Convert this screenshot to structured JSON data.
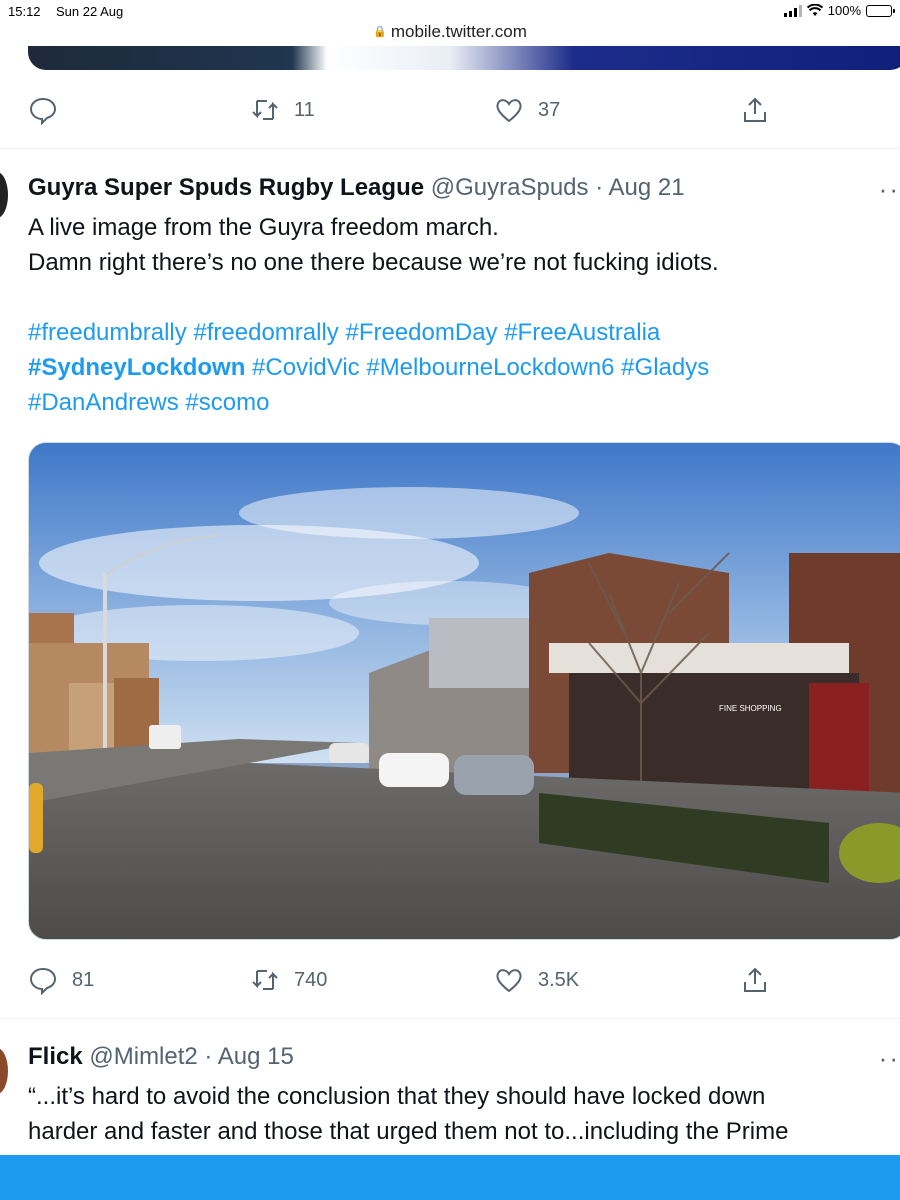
{
  "status_bar": {
    "time": "15:12",
    "date": "Sun 22 Aug",
    "battery": "100%"
  },
  "browser": {
    "url": "mobile.twitter.com"
  },
  "prev_tweet_actions": {
    "replies": "",
    "retweets": "11",
    "likes": "37"
  },
  "tweet": {
    "name": "Guyra Super Spuds Rugby League",
    "handle": "@GuyraSpuds",
    "separator": "·",
    "date": "Aug 21",
    "more": "··",
    "text_lines": [
      "A live image from the Guyra freedom march.",
      "Damn right there’s no one there because we’re not fucking idiots."
    ],
    "hashtags": {
      "line1": "#freedumbrally #freedomrally #FreedomDay #FreeAustralia",
      "line2_bold": "#SydneyLockdown",
      "line2_rest": " #CovidVic #MelbourneLockdown6 #Gladys",
      "line3": "#DanAndrews #scomo"
    },
    "photo": {
      "shop_sign": "FINE SHOPPING"
    },
    "actions": {
      "replies": "81",
      "retweets": "740",
      "likes": "3.5K"
    }
  },
  "next_tweet": {
    "name": "Flick",
    "handle": "@Mimlet2",
    "separator": "·",
    "date": "Aug 15",
    "more": "··",
    "text_lines": [
      "“...it’s hard to avoid the conclusion that they should have locked down",
      "harder and faster and those that urged them not to...including the Prime"
    ]
  },
  "colors": {
    "link": "#1d9bf0",
    "muted": "#536471",
    "bottom_bar": "#1d9bf0"
  }
}
